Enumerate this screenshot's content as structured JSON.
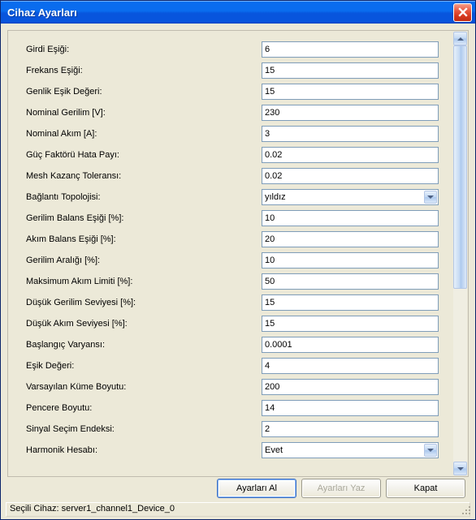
{
  "window": {
    "title": "Cihaz Ayarları"
  },
  "fields": [
    {
      "label": "Girdi Eşiği:",
      "type": "text",
      "value": "6"
    },
    {
      "label": "Frekans Eşiği:",
      "type": "text",
      "value": "15"
    },
    {
      "label": "Genlik Eşik Değeri:",
      "type": "text",
      "value": "15"
    },
    {
      "label": "Nominal Gerilim [V]:",
      "type": "text",
      "value": "230"
    },
    {
      "label": "Nominal Akım [A]:",
      "type": "text",
      "value": "3"
    },
    {
      "label": "Güç Faktörü Hata Payı:",
      "type": "text",
      "value": "0.02"
    },
    {
      "label": "Mesh Kazanç Toleransı:",
      "type": "text",
      "value": "0.02"
    },
    {
      "label": "Bağlantı Topolojisi:",
      "type": "select",
      "value": "yıldız"
    },
    {
      "label": "Gerilim Balans Eşiği [%]:",
      "type": "text",
      "value": "10"
    },
    {
      "label": "Akım Balans Eşiği [%]:",
      "type": "text",
      "value": "20"
    },
    {
      "label": "Gerilim Aralığı [%]:",
      "type": "text",
      "value": "10"
    },
    {
      "label": "Maksimum Akım Limiti [%]:",
      "type": "text",
      "value": "50"
    },
    {
      "label": "Düşük Gerilim Seviyesi [%]:",
      "type": "text",
      "value": "15"
    },
    {
      "label": "Düşük Akım Seviyesi [%]:",
      "type": "text",
      "value": "15"
    },
    {
      "label": "Başlangıç Varyansı:",
      "type": "text",
      "value": "0.0001"
    },
    {
      "label": "Eşik Değeri:",
      "type": "text",
      "value": "4"
    },
    {
      "label": "Varsayılan Küme Boyutu:",
      "type": "text",
      "value": "200"
    },
    {
      "label": "Pencere Boyutu:",
      "type": "text",
      "value": "14"
    },
    {
      "label": "Sinyal Seçim Endeksi:",
      "type": "text",
      "value": "2"
    },
    {
      "label": "Harmonik Hesabı:",
      "type": "select",
      "value": "Evet"
    }
  ],
  "buttons": {
    "get": "Ayarları Al",
    "set": "Ayarları Yaz",
    "close": "Kapat"
  },
  "status": {
    "text": "Seçili Cihaz: server1_channel1_Device_0"
  }
}
